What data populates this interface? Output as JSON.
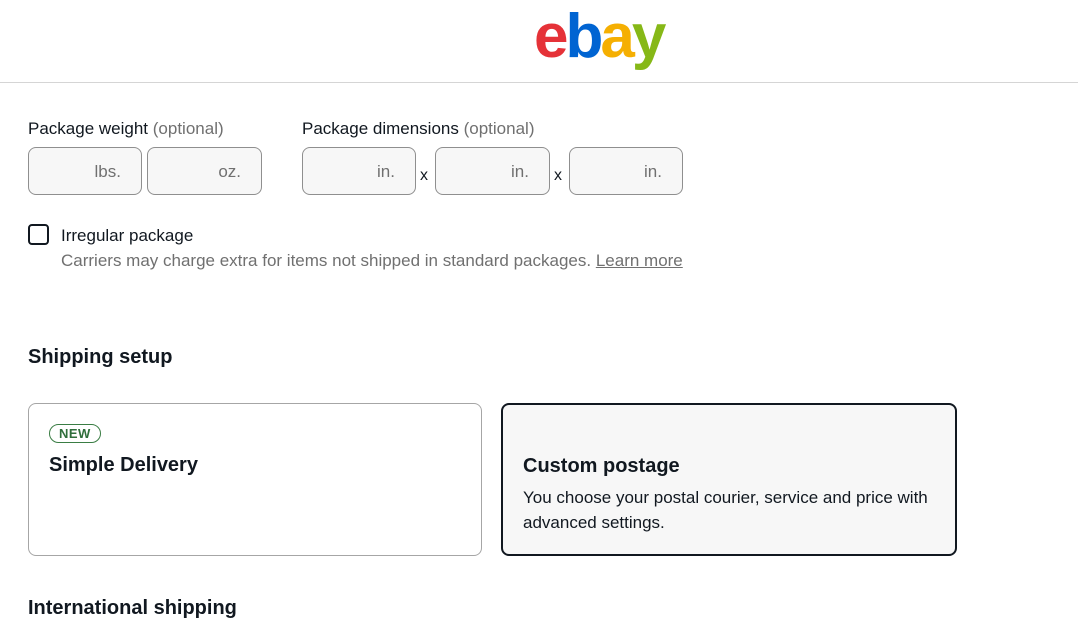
{
  "logo": {
    "e": "e",
    "b": "b",
    "a": "a",
    "y": "y"
  },
  "package_weight": {
    "label": "Package weight",
    "optional": "(optional)",
    "lbs_unit": "lbs.",
    "oz_unit": "oz."
  },
  "package_dimensions": {
    "label": "Package dimensions",
    "optional": "(optional)",
    "unit": "in.",
    "separator": "x"
  },
  "irregular_package": {
    "label": "Irregular package",
    "help_text": "Carriers may charge extra for items not shipped in standard packages.",
    "learn_more": "Learn more",
    "checked": false
  },
  "shipping_setup": {
    "title": "Shipping setup",
    "simple_delivery": {
      "badge": "NEW",
      "title": "Simple Delivery"
    },
    "custom_postage": {
      "title": "Custom postage",
      "description": "You choose your postal courier, service and price with advanced settings.",
      "selected": true
    }
  },
  "international_shipping": {
    "title": "International shipping"
  }
}
